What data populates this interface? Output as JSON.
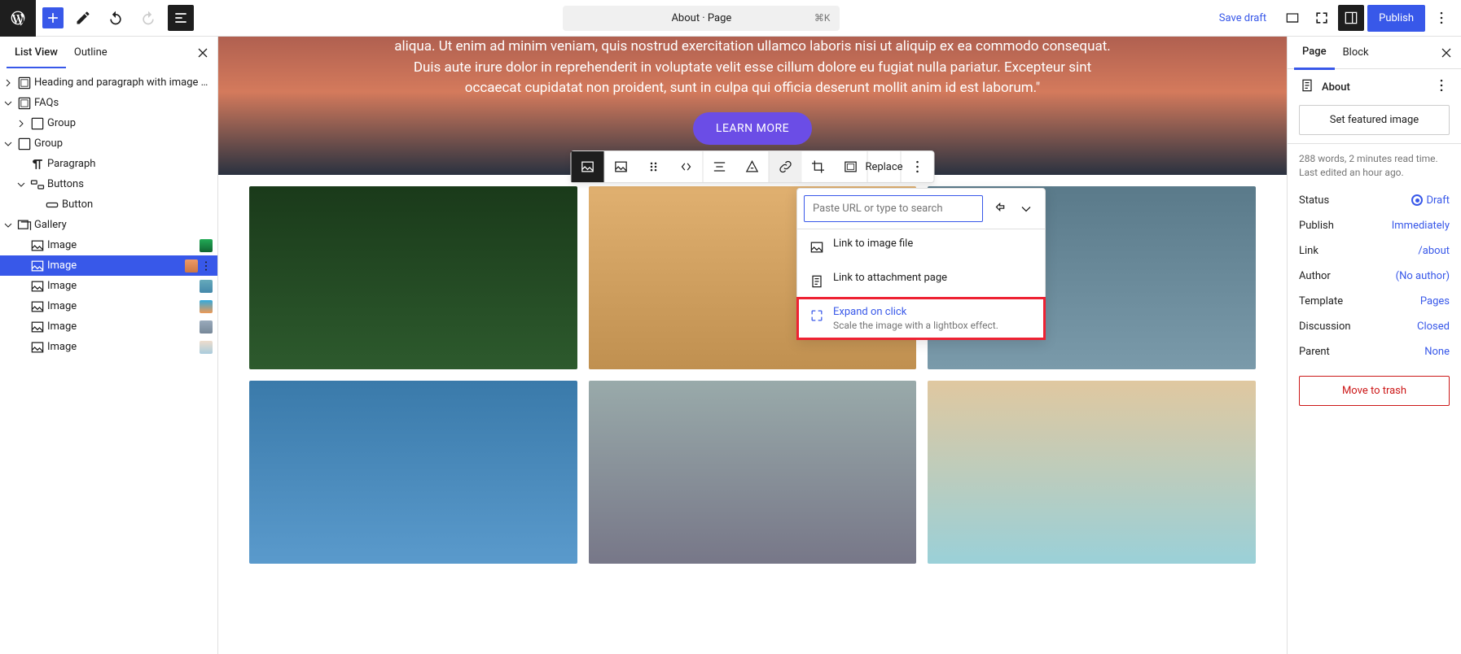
{
  "topbar": {
    "doc_title": "About · Page",
    "kbd": "⌘K",
    "save_draft": "Save draft",
    "publish": "Publish"
  },
  "left_tabs": {
    "list_view": "List View",
    "outline": "Outline"
  },
  "tree": {
    "heading_para": "Heading and paragraph with image on t…",
    "faqs": "FAQs",
    "group_inner": "Group",
    "group": "Group",
    "paragraph": "Paragraph",
    "buttons": "Buttons",
    "button": "Button",
    "gallery": "Gallery",
    "image": "Image"
  },
  "hero": {
    "text": "aliqua. Ut enim ad minim veniam, quis nostrud exercitation ullamco laboris nisi ut aliquip ex ea commodo consequat. Duis aute irure dolor in reprehenderit in voluptate velit esse cillum dolore eu fugiat nulla pariatur. Excepteur sint occaecat cupidatat non proident, sunt in culpa qui officia deserunt mollit anim id est laborum.\"",
    "cta": "LEARN MORE"
  },
  "block_toolbar": {
    "replace": "Replace"
  },
  "link_popover": {
    "placeholder": "Paste URL or type to search",
    "link_image_file": "Link to image file",
    "link_attachment": "Link to attachment page",
    "expand_title": "Expand on click",
    "expand_desc": "Scale the image with a lightbox effect."
  },
  "right_tabs": {
    "page": "Page",
    "block": "Block"
  },
  "right_panel": {
    "title": "About",
    "featured": "Set featured image",
    "meta": "288 words, 2 minutes read time. Last edited an hour ago.",
    "status_k": "Status",
    "status_v": "Draft",
    "publish_k": "Publish",
    "publish_v": "Immediately",
    "link_k": "Link",
    "link_v": "/about",
    "author_k": "Author",
    "author_v": "(No author)",
    "template_k": "Template",
    "template_v": "Pages",
    "discussion_k": "Discussion",
    "discussion_v": "Closed",
    "parent_k": "Parent",
    "parent_v": "None",
    "trash": "Move to trash"
  }
}
